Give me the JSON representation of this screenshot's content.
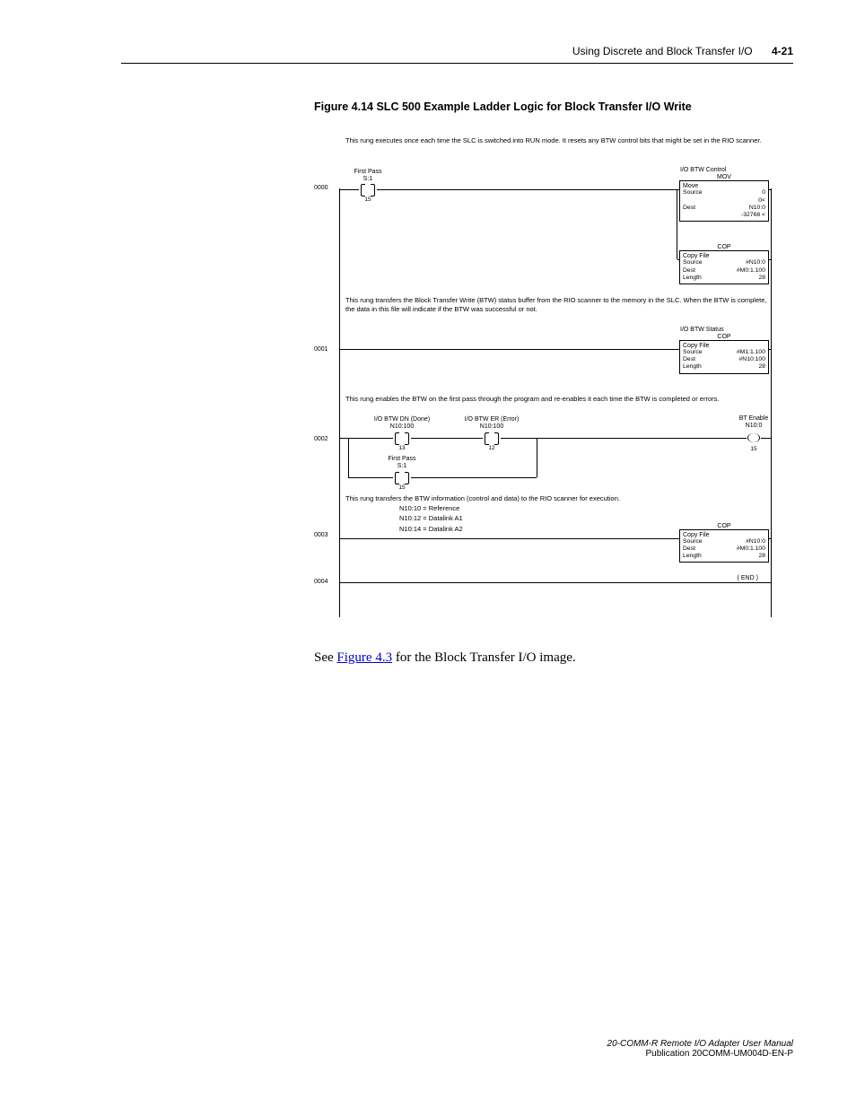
{
  "header": {
    "title": "Using Discrete and Block Transfer I/O",
    "page": "4-21"
  },
  "figure_caption": "Figure 4.14    SLC 500 Example Ladder Logic for Block Transfer I/O Write",
  "rungs": {
    "r0": {
      "num": "0000",
      "desc": "This rung executes once each time the SLC is switched into RUN mode. It resets any BTW control bits that might be set in the RIO scanner.",
      "contact1_l1": "First Pass",
      "contact1_l2": "S:1",
      "contact1_sub": "15",
      "mov_header": "I/O BTW Control",
      "mov_title": "MOV",
      "mov_name": "Move",
      "mov_src_l": "Source",
      "mov_src_v": "0",
      "mov_src2_v": "0<",
      "mov_dst_l": "Dest",
      "mov_dst_v": "N10:0",
      "mov_dst2_v": "-32768  <",
      "cop_title": "COP",
      "cop_name": "Copy File",
      "cop_src_l": "Source",
      "cop_src_v": "#N10:0",
      "cop_dst_l": "Dest",
      "cop_dst_v": "#M0:1.100",
      "cop_len_l": "Length",
      "cop_len_v": "28"
    },
    "r1": {
      "num": "0001",
      "desc": "This rung transfers the Block Transfer Write (BTW) status buffer from the RIO scanner to the memory in the SLC. When the BTW is complete, the data in this file will indicate if the BTW was successful or not.",
      "cop_header": "I/O BTW Status",
      "cop_title": "COP",
      "cop_name": "Copy File",
      "cop_src_l": "Source",
      "cop_src_v": "#M1:1.100",
      "cop_dst_l": "Dest",
      "cop_dst_v": "#N10:100",
      "cop_len_l": "Length",
      "cop_len_v": "28"
    },
    "r2": {
      "num": "0002",
      "desc": "This rung enables the BTW on the first pass through the program and re-enables it each time the BTW is completed or errors.",
      "c1_l1": "I/O BTW DN (Done)",
      "c1_l2": "N10:100",
      "c1_sub": "13",
      "c2_l1": "I/O BTW ER (Error)",
      "c2_l2": "N10:100",
      "c2_sub": "12",
      "c3_l1": "First Pass",
      "c3_l2": "S:1",
      "c3_sub": "15",
      "coil_l1": "BT Enable",
      "coil_l2": "N10:0",
      "coil_sub": "15"
    },
    "r3": {
      "num": "0003",
      "desc": "This rung transfers the BTW information (control and data) to the RIO scanner for execution.",
      "sub1": "N10:10 = Reference",
      "sub2": "N10:12 = Datalink A1",
      "sub3": "N10:14 = Datalink A2",
      "cop_title": "COP",
      "cop_name": "Copy File",
      "cop_src_l": "Source",
      "cop_src_v": "#N10:0",
      "cop_dst_l": "Dest",
      "cop_dst_v": "#M0:1.100",
      "cop_len_l": "Length",
      "cop_len_v": "28"
    },
    "r4": {
      "num": "0004",
      "end": "END"
    }
  },
  "body": {
    "pre": "See ",
    "link": "Figure 4.3",
    "post": " for the Block Transfer I/O image."
  },
  "footer": {
    "l1": "20-COMM-R Remote I/O Adapter User Manual",
    "l2": "Publication 20COMM-UM004D-EN-P"
  }
}
